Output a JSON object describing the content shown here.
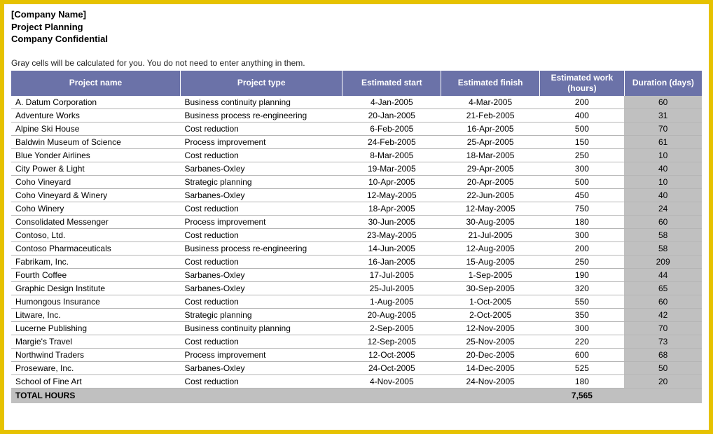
{
  "header": {
    "company": "[Company Name]",
    "title": "Project Planning",
    "confidential": "Company Confidential",
    "note": "Gray cells will be calculated for you. You do not need to enter anything in them."
  },
  "columns": {
    "name": "Project name",
    "type": "Project type",
    "start": "Estimated start",
    "finish": "Estimated finish",
    "work": "Estimated work (hours)",
    "dur": "Duration (days)"
  },
  "rows": [
    {
      "name": "A. Datum Corporation",
      "type": "Business continuity planning",
      "start": "4-Jan-2005",
      "finish": "4-Mar-2005",
      "work": "200",
      "dur": "60"
    },
    {
      "name": "Adventure Works",
      "type": "Business process re-engineering",
      "start": "20-Jan-2005",
      "finish": "21-Feb-2005",
      "work": "400",
      "dur": "31"
    },
    {
      "name": "Alpine Ski House",
      "type": "Cost reduction",
      "start": "6-Feb-2005",
      "finish": "16-Apr-2005",
      "work": "500",
      "dur": "70"
    },
    {
      "name": "Baldwin Museum of Science",
      "type": "Process improvement",
      "start": "24-Feb-2005",
      "finish": "25-Apr-2005",
      "work": "150",
      "dur": "61"
    },
    {
      "name": "Blue Yonder Airlines",
      "type": "Cost reduction",
      "start": "8-Mar-2005",
      "finish": "18-Mar-2005",
      "work": "250",
      "dur": "10"
    },
    {
      "name": "City Power & Light",
      "type": "Sarbanes-Oxley",
      "start": "19-Mar-2005",
      "finish": "29-Apr-2005",
      "work": "300",
      "dur": "40"
    },
    {
      "name": "Coho Vineyard",
      "type": "Strategic planning",
      "start": "10-Apr-2005",
      "finish": "20-Apr-2005",
      "work": "500",
      "dur": "10"
    },
    {
      "name": "Coho Vineyard & Winery",
      "type": "Sarbanes-Oxley",
      "start": "12-May-2005",
      "finish": "22-Jun-2005",
      "work": "450",
      "dur": "40"
    },
    {
      "name": "Coho Winery",
      "type": "Cost reduction",
      "start": "18-Apr-2005",
      "finish": "12-May-2005",
      "work": "750",
      "dur": "24"
    },
    {
      "name": "Consolidated Messenger",
      "type": "Process improvement",
      "start": "30-Jun-2005",
      "finish": "30-Aug-2005",
      "work": "180",
      "dur": "60"
    },
    {
      "name": "Contoso, Ltd.",
      "type": "Cost reduction",
      "start": "23-May-2005",
      "finish": "21-Jul-2005",
      "work": "300",
      "dur": "58"
    },
    {
      "name": "Contoso Pharmaceuticals",
      "type": "Business process re-engineering",
      "start": "14-Jun-2005",
      "finish": "12-Aug-2005",
      "work": "200",
      "dur": "58"
    },
    {
      "name": "Fabrikam, Inc.",
      "type": "Cost reduction",
      "start": "16-Jan-2005",
      "finish": "15-Aug-2005",
      "work": "250",
      "dur": "209"
    },
    {
      "name": "Fourth Coffee",
      "type": "Sarbanes-Oxley",
      "start": "17-Jul-2005",
      "finish": "1-Sep-2005",
      "work": "190",
      "dur": "44"
    },
    {
      "name": "Graphic Design Institute",
      "type": "Sarbanes-Oxley",
      "start": "25-Jul-2005",
      "finish": "30-Sep-2005",
      "work": "320",
      "dur": "65"
    },
    {
      "name": "Humongous Insurance",
      "type": "Cost reduction",
      "start": "1-Aug-2005",
      "finish": "1-Oct-2005",
      "work": "550",
      "dur": "60"
    },
    {
      "name": "Litware, Inc.",
      "type": "Strategic planning",
      "start": "20-Aug-2005",
      "finish": "2-Oct-2005",
      "work": "350",
      "dur": "42"
    },
    {
      "name": "Lucerne Publishing",
      "type": "Business continuity planning",
      "start": "2-Sep-2005",
      "finish": "12-Nov-2005",
      "work": "300",
      "dur": "70"
    },
    {
      "name": "Margie's Travel",
      "type": "Cost reduction",
      "start": "12-Sep-2005",
      "finish": "25-Nov-2005",
      "work": "220",
      "dur": "73"
    },
    {
      "name": "Northwind Traders",
      "type": "Process improvement",
      "start": "12-Oct-2005",
      "finish": "20-Dec-2005",
      "work": "600",
      "dur": "68"
    },
    {
      "name": "Proseware, Inc.",
      "type": "Sarbanes-Oxley",
      "start": "24-Oct-2005",
      "finish": "14-Dec-2005",
      "work": "525",
      "dur": "50"
    },
    {
      "name": "School of Fine Art",
      "type": "Cost reduction",
      "start": "4-Nov-2005",
      "finish": "24-Nov-2005",
      "work": "180",
      "dur": "20"
    }
  ],
  "total": {
    "label": "TOTAL HOURS",
    "value": "7,565"
  }
}
